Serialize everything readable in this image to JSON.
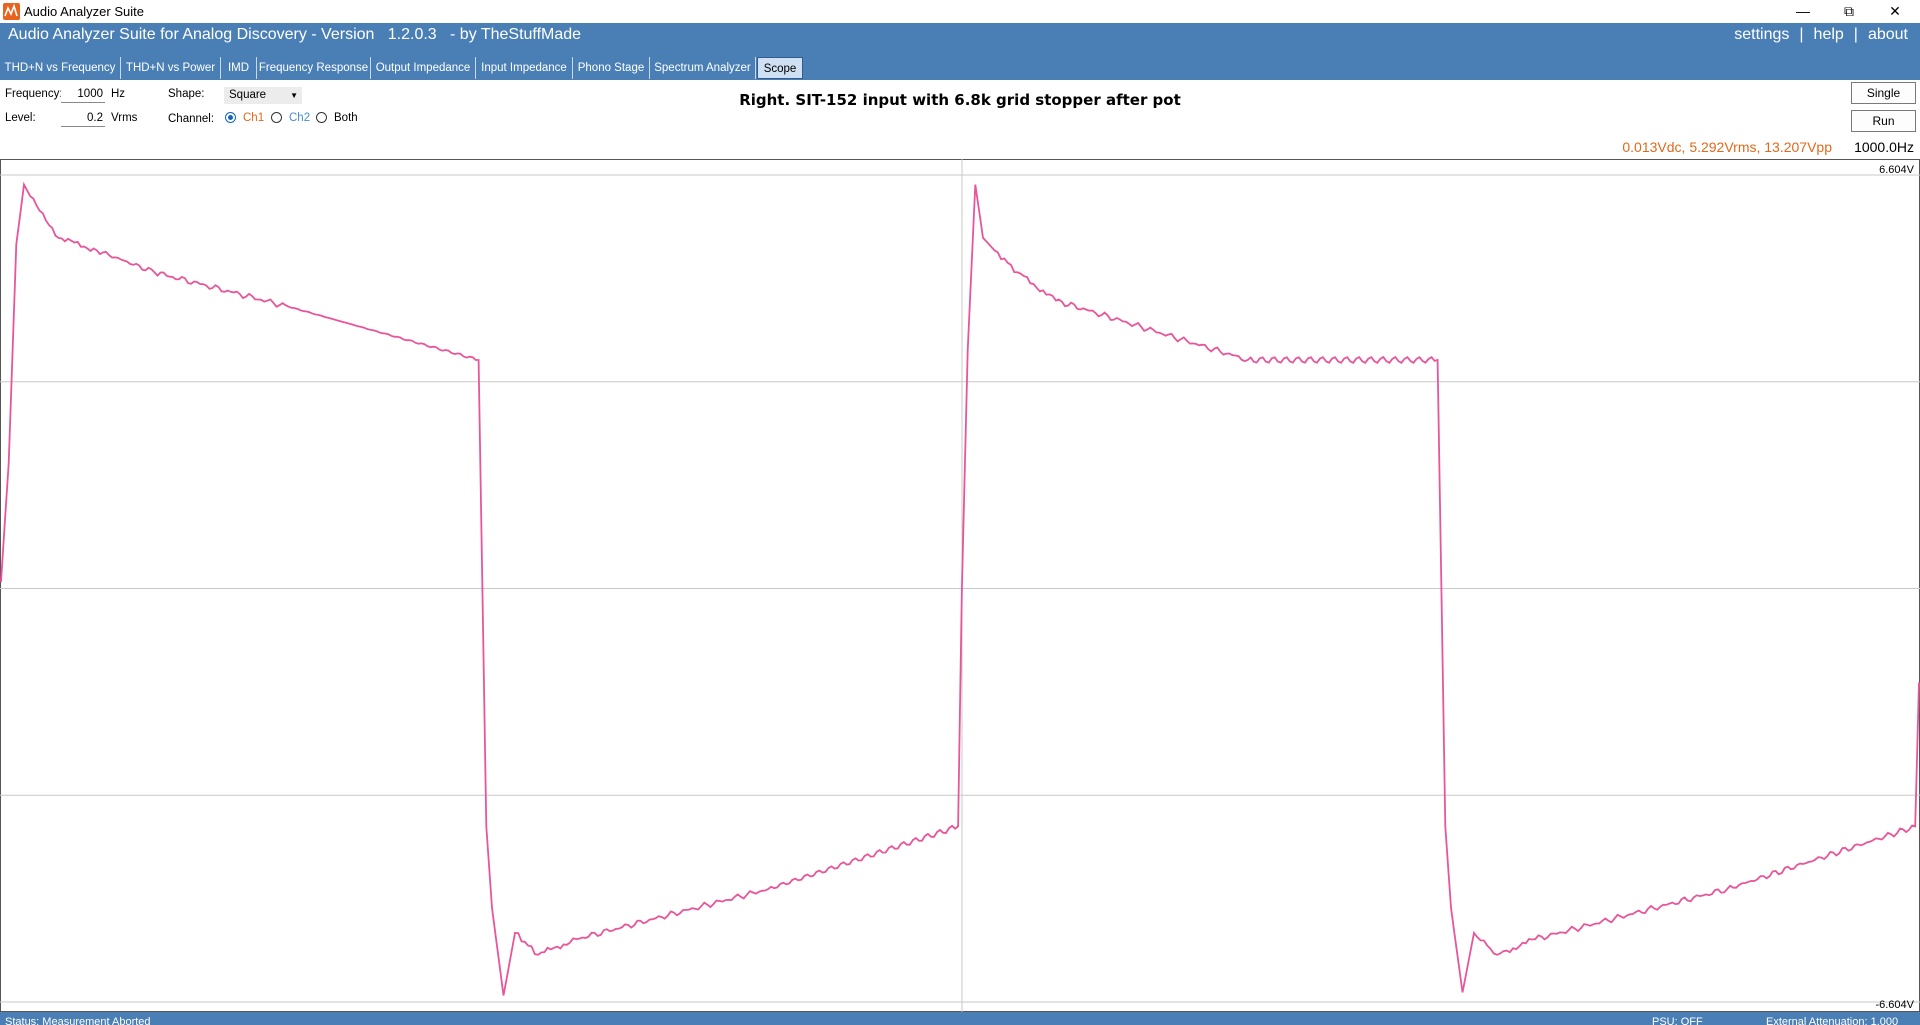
{
  "window": {
    "title": "Audio Analyzer Suite",
    "minimize": "—",
    "restore": "⧉",
    "close": "✕"
  },
  "header": {
    "title": "Audio Analyzer Suite for Analog Discovery - Version   1.2.0.3   - by TheStuffMade",
    "links": {
      "settings": "settings",
      "help": "help",
      "about": "about",
      "sep": "|"
    }
  },
  "tabs": [
    {
      "label": "THD+N vs Frequency"
    },
    {
      "label": "THD+N vs Power"
    },
    {
      "label": "IMD"
    },
    {
      "label": "Frequency Response"
    },
    {
      "label": "Output Impedance"
    },
    {
      "label": "Input Impedance"
    },
    {
      "label": "Phono Stage"
    },
    {
      "label": "Spectrum Analyzer"
    },
    {
      "label": "Scope",
      "active": true
    }
  ],
  "controls": {
    "frequency_label": "Frequency:",
    "frequency_value": "1000",
    "frequency_unit": "Hz",
    "level_label": "Level:",
    "level_value": "0.2",
    "level_unit": "Vrms",
    "shape_label": "Shape:",
    "shape_value": "Square",
    "channel_label": "Channel:",
    "channels": [
      "Ch1",
      "Ch2",
      "Both"
    ],
    "channel_selected": "Ch1",
    "single_button": "Single",
    "run_button": "Run"
  },
  "chart_title": "Right. SIT-152 input with 6.8k grid stopper after pot",
  "readout": "0.013Vdc, 5.292Vrms, 13.207Vpp",
  "freq_readout": "1000.0Hz",
  "colors": {
    "accent": "#4a7fb5",
    "trace": "#e8569a",
    "readout": "#e0691c",
    "ch1": "#e0691c",
    "ch2": "#4a90c8"
  },
  "chart_data": {
    "type": "line",
    "xlabel": "",
    "ylabel": "",
    "ylim": [
      -6.604,
      6.604
    ],
    "y_top_label": "6.604V",
    "y_bottom_label": "-6.604V",
    "grid": true,
    "series": [
      {
        "x_fraction": [
          0.0,
          0.004,
          0.008,
          0.012,
          0.03,
          0.05,
          0.08,
          0.15,
          0.249,
          0.251,
          0.253,
          0.256,
          0.262,
          0.268,
          0.28,
          0.3,
          0.4,
          0.499,
          0.501,
          0.504,
          0.508,
          0.512,
          0.518,
          0.53,
          0.55,
          0.65,
          0.749,
          0.751,
          0.753,
          0.756,
          0.762,
          0.768,
          0.78,
          0.8,
          0.9,
          0.998,
          1.0
        ],
        "values": [
          0.1,
          2.0,
          5.5,
          6.45,
          5.6,
          5.4,
          5.05,
          4.5,
          3.65,
          0.0,
          -3.8,
          -5.1,
          -6.5,
          -5.5,
          -5.85,
          -5.6,
          -4.8,
          -3.8,
          0.0,
          3.8,
          6.45,
          5.6,
          5.4,
          5.05,
          4.6,
          3.65,
          3.65,
          0.0,
          -3.8,
          -5.1,
          -6.45,
          -5.5,
          -5.85,
          -5.6,
          -4.8,
          -3.8,
          -1.5
        ]
      }
    ]
  },
  "status": {
    "left": "Status: Measurement Aborted",
    "psu": "PSU: OFF",
    "attenuation": "External Attenuation: 1.000"
  }
}
